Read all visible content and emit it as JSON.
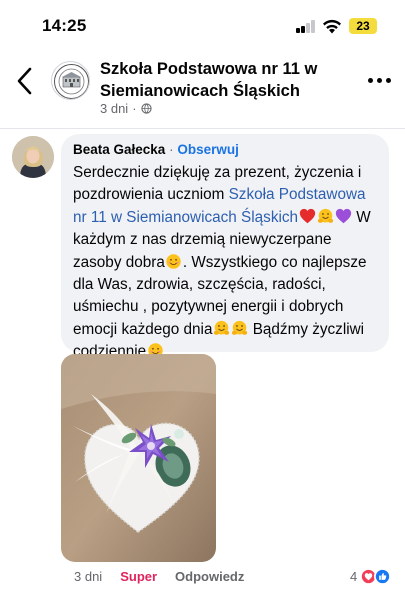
{
  "status_bar": {
    "time": "14:25",
    "battery": "23"
  },
  "header": {
    "page_name": "Szkoła Podstawowa nr 11 w Siemianowicach Śląskich",
    "time_ago": "3 dni",
    "dot": "·",
    "icons": [
      "back-arrow-icon",
      "school-logo",
      "globe-icon",
      "more-icon"
    ]
  },
  "comment": {
    "author": "Beata Gałecka",
    "separator": "·",
    "follow_label": "Obserwuj",
    "text_1": "Serdecznie dziękuję za prezent, życzenia i pozdrowienia uczniom ",
    "mention": "Szkoła Podstawowa nr 11 w Siemianowicach Śląskich",
    "text_2": "W każdym z nas drzemią niewyczerpane zasoby dobra",
    "text_3": ". Wszystkiego co najlepsze dla Was, zdrowia, szczęścia, radości, uśmiechu , pozytywnej energii  i dobrych emocji każdego dnia",
    "text_4": "Bądźmy życzliwi codziennie",
    "emojis": [
      "red-heart-emoji",
      "hugging-face-emoji",
      "purple-heart-emoji",
      "smiling-face-emoji",
      "hugging-face-emoji",
      "smiling-face-emoji"
    ]
  },
  "actions": {
    "time_ago": "3 dni",
    "reaction_label": "Super",
    "reply_label": "Odpowiedz",
    "reaction_count": "4",
    "reaction_icons": [
      "love-reaction-icon",
      "like-reaction-icon"
    ],
    "super_color": "#e0245e",
    "follow_color": "#1b74e4"
  }
}
